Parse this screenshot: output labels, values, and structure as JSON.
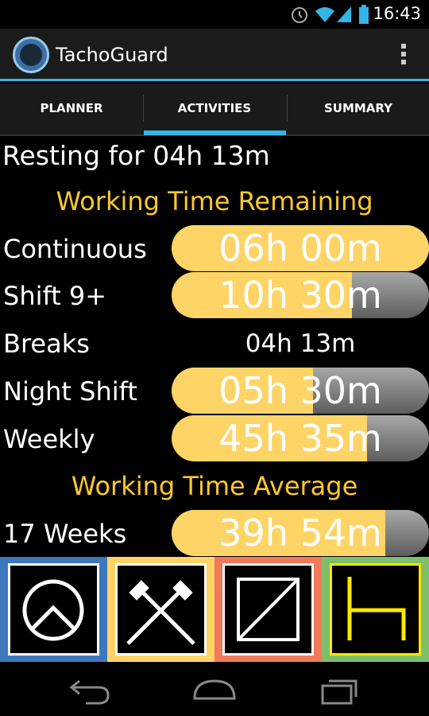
{
  "status_bar": {
    "time": "16:43"
  },
  "app": {
    "title": "TachoGuard"
  },
  "tabs": [
    {
      "label": "PLANNER",
      "selected": false
    },
    {
      "label": "ACTIVITIES",
      "selected": true
    },
    {
      "label": "SUMMARY",
      "selected": false
    }
  ],
  "resting_text": "Resting for 04h 13m",
  "remaining": {
    "heading": "Working Time Remaining",
    "continuous": {
      "label": "Continuous",
      "value": "06h 00m",
      "fill_fraction": 1.0
    },
    "shift": {
      "label": "Shift 9+",
      "value": "10h 30m",
      "fill_fraction": 0.7
    },
    "breaks": {
      "label": "Breaks",
      "value": "04h 13m"
    },
    "night_shift": {
      "label": "Night Shift",
      "value": "05h 30m",
      "fill_fraction": 0.55
    },
    "weekly": {
      "label": "Weekly",
      "value": "45h 35m",
      "fill_fraction": 0.76
    }
  },
  "average": {
    "heading": "Working Time Average",
    "weeks17": {
      "label": "17 Weeks",
      "value": "39h 54m",
      "fill_fraction": 0.83
    }
  },
  "activities": [
    {
      "name": "rest",
      "icon": "bed-icon",
      "color": "#3d78bd"
    },
    {
      "name": "work",
      "icon": "crossed-hammers-icon",
      "color": "#fdd465"
    },
    {
      "name": "availability",
      "icon": "slashed-square-icon",
      "color": "#f07a5a"
    },
    {
      "name": "driving",
      "icon": "steering-wheel-icon",
      "color": "#7fbf6a"
    }
  ],
  "colors": {
    "accent": "#33b5e5",
    "heading": "#ffc82c",
    "bar_fill": "#fed466"
  }
}
